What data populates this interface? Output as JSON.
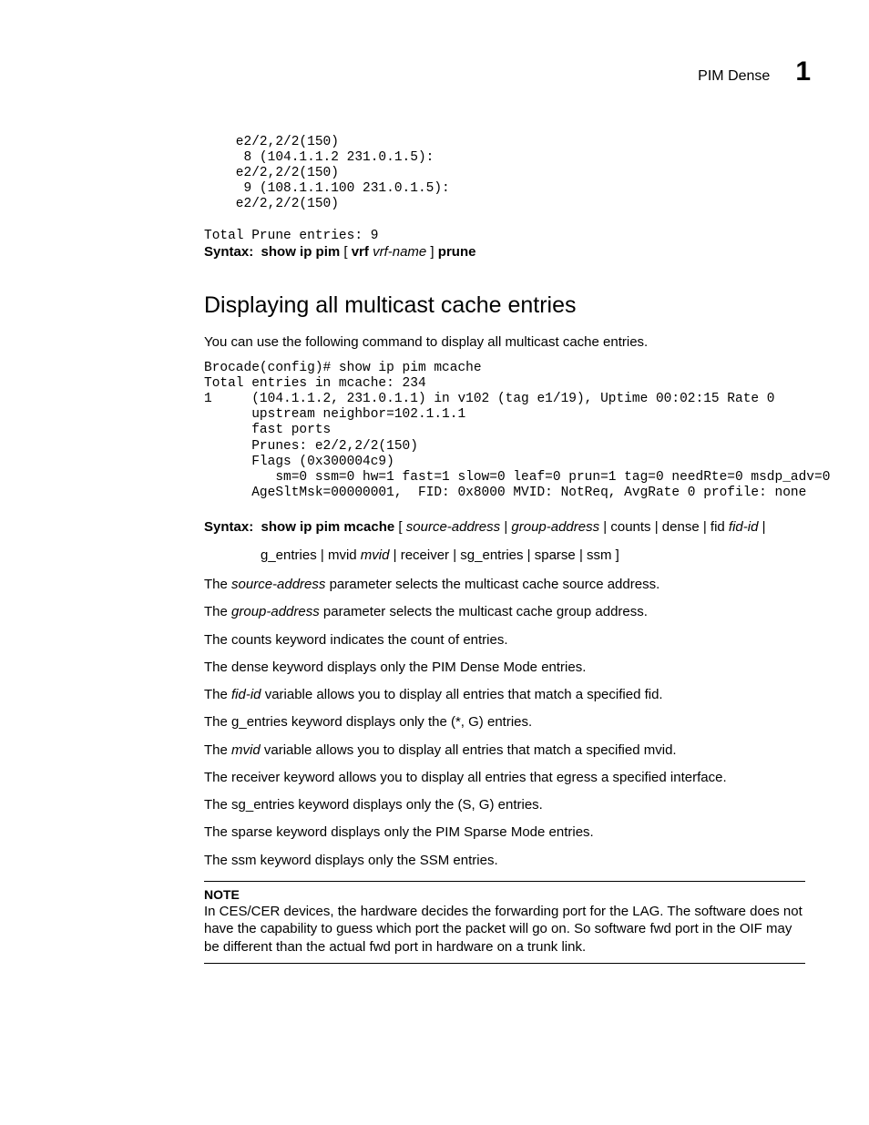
{
  "header": {
    "title": "PIM Dense",
    "chapter": "1"
  },
  "code1": {
    "l1": "    e2/2,2/2(150)",
    "l2": "     8 (104.1.1.2 231.0.1.5):",
    "l3": "    e2/2,2/2(150)",
    "l4": "     9 (108.1.1.100 231.0.1.5):",
    "l5": "    e2/2,2/2(150)",
    "blank": "",
    "l6": "Total Prune entries: 9"
  },
  "syntax1": {
    "label": "Syntax:",
    "cmd": "show ip pim",
    "opt1": " [ ",
    "vrf": "vrf",
    "sp": " ",
    "vrfname": "vrf-name",
    "opt2": " ] ",
    "prune": "prune"
  },
  "heading": "Displaying all multicast cache entries",
  "intro": "You can use the following command to display all multicast cache entries.",
  "code2": {
    "l1": "Brocade(config)# show ip pim mcache",
    "l2": "Total entries in mcache: 234",
    "l3": "1     (104.1.1.2, 231.0.1.1) in v102 (tag e1/19), Uptime 00:02:15 Rate 0",
    "l4": "      upstream neighbor=102.1.1.1",
    "l5": "      fast ports",
    "l6": "      Prunes: e2/2,2/2(150)",
    "l7": "      Flags (0x300004c9)",
    "l8": "         sm=0 ssm=0 hw=1 fast=1 slow=0 leaf=0 prun=1 tag=0 needRte=0 msdp_adv=0",
    "l9": "      AgeSltMsk=00000001,  FID: 0x8000 MVID: NotReq, AvgRate 0 profile: none"
  },
  "syntax2": {
    "label": "Syntax:",
    "cmd": "show ip pim mcache",
    "br1": " [ ",
    "src": "source-address",
    "pipe": " | ",
    "grp": "group-address",
    "counts": "counts",
    "dense": "dense",
    "fid": "fid",
    "fidid": "fid-id",
    "gent": "g_entries",
    "mvidk": "mvid",
    "mvidv": "mvid",
    "recv": "receiver",
    "sgent": "sg_entries",
    "sparse": "sparse",
    "ssm": "ssm",
    "brend": " ]"
  },
  "paras": {
    "p1a": "The ",
    "p1i": "source-address",
    "p1b": " parameter selects the multicast cache source address.",
    "p2a": "The ",
    "p2i": "group-address",
    "p2b": " parameter selects the multicast cache group address.",
    "p3": "The counts keyword indicates the count of entries.",
    "p4": "The dense keyword displays only the PIM Dense Mode entries.",
    "p5a": "The ",
    "p5i": "fid-id",
    "p5b": " variable allows you to display all  entries that match a specified fid.",
    "p6": "The g_entries keyword displays only the (*, G) entries.",
    "p7a": "The ",
    "p7i": "mvid",
    "p7b": " variable allows you to display all entries that match a specified mvid.",
    "p8": "The receiver keyword allows you to display all entries that egress a specified interface.",
    "p9": "The sg_entries keyword displays only the (S, G) entries.",
    "p10": "The sparse keyword displays only the PIM Sparse Mode entries.",
    "p11": "The ssm keyword displays only the SSM entries."
  },
  "note": {
    "label": "NOTE",
    "text": "In CES/CER devices, the hardware decides the forwarding port for the LAG. The software does not have the capability to  guess which port the packet will go on. So software fwd port in the OIF may be different than the actual fwd port in hardware on a trunk link."
  }
}
